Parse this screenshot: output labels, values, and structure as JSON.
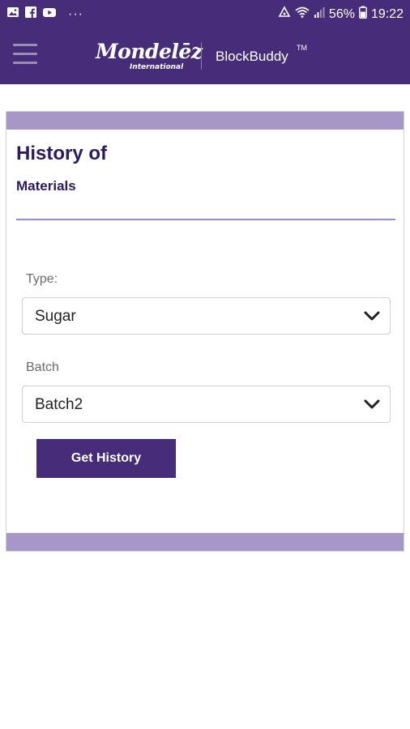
{
  "status_bar": {
    "battery": "56%",
    "time": "19:22",
    "icons": [
      "image-icon",
      "facebook-icon",
      "youtube-icon",
      "more-dots-icon",
      "alarm-icon",
      "wifi-icon",
      "signal-icon",
      "battery-icon"
    ]
  },
  "app_bar": {
    "brand_main": "Mondelēz",
    "brand_sub": "International",
    "app_name": "BlockBuddy",
    "trademark": "TM"
  },
  "card": {
    "title": "History of",
    "subtitle": "Materials",
    "type_label": "Type:",
    "type_value": "Sugar",
    "batch_label": "Batch",
    "batch_value": "Batch2",
    "button_label": "Get History"
  },
  "colors": {
    "brand_purple": "#472c7a",
    "band_lavender": "#a797c9",
    "title_navy": "#2c1a5e"
  }
}
